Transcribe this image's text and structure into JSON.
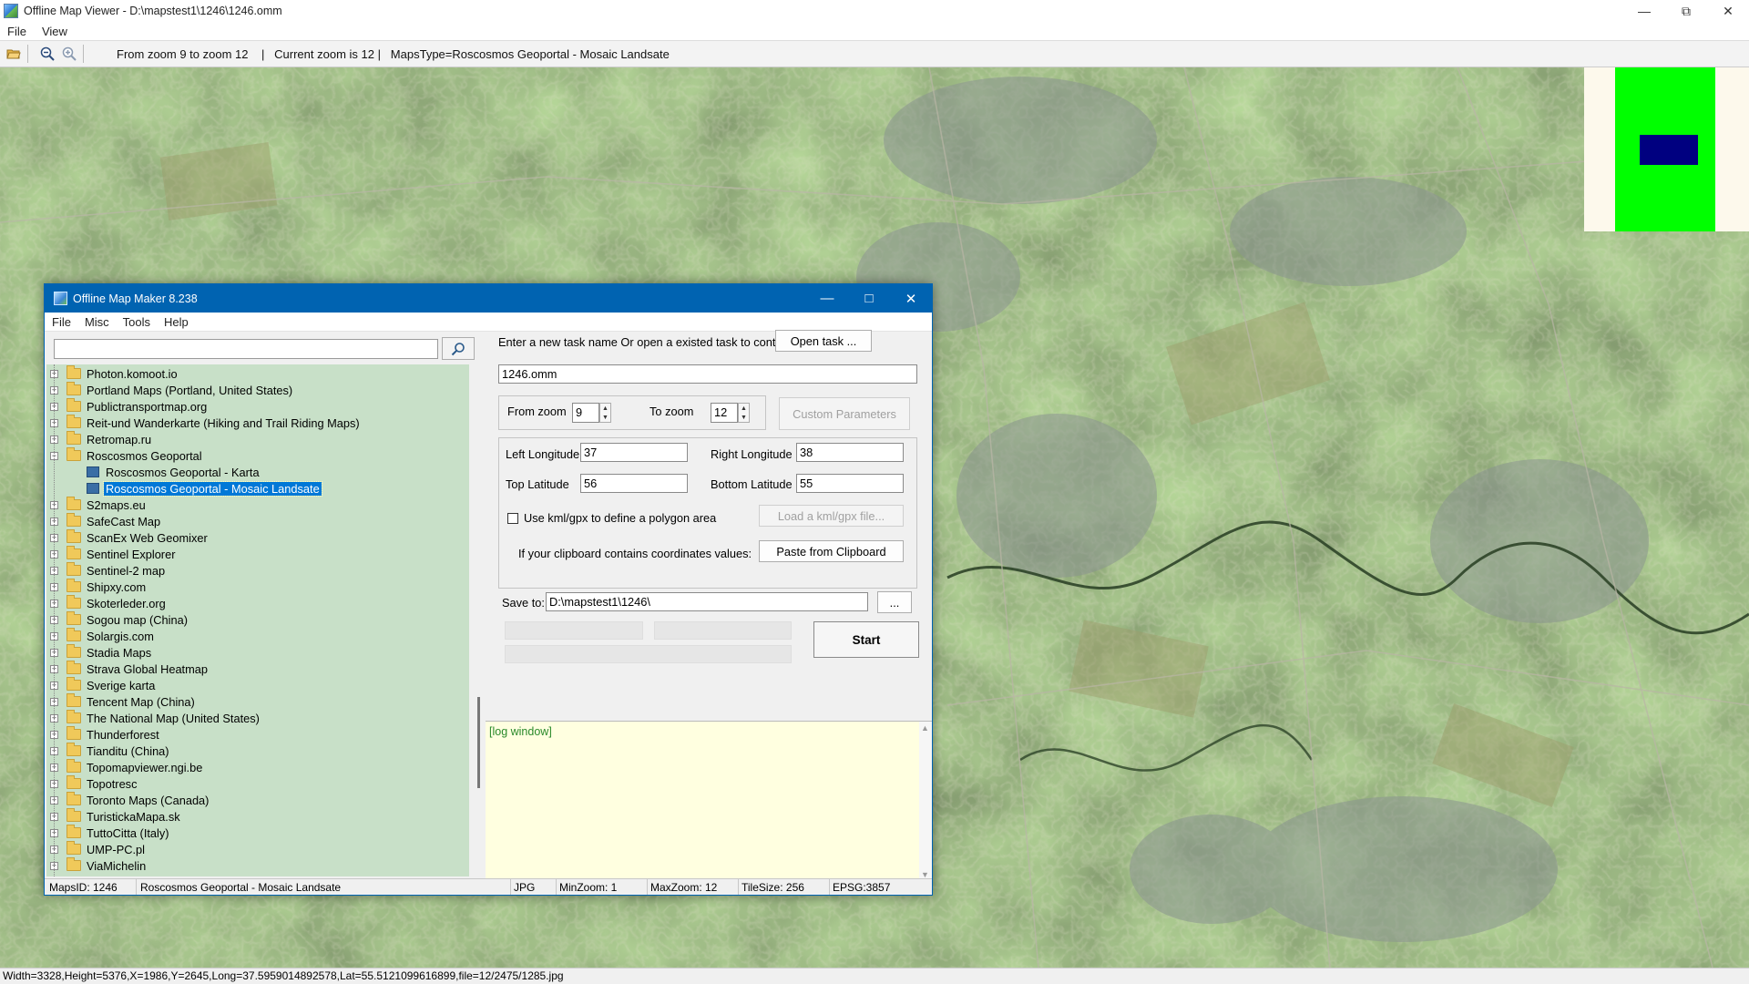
{
  "viewer": {
    "title": "Offline Map Viewer - D:\\mapstest1\\1246\\1246.omm",
    "menu": [
      "File",
      "View"
    ],
    "toolbar_info": "From zoom 9 to zoom 12    |   Current zoom is 12 |   MapsType=Roscosmos Geoportal - Mosaic Landsate",
    "status": "Width=3328,Height=5376,X=1986,Y=2645,Long=37.5959014892578,Lat=55.5121099616899,file=12/2475/1285.jpg",
    "icons": [
      "folder-open-icon",
      "zoom-out-icon",
      "zoom-in-icon"
    ],
    "colors": {
      "minimap_bg": "#fdf9ec",
      "minimap_map": "#00ff00",
      "minimap_view": "#000080"
    }
  },
  "dialog": {
    "title": "Offline Map Maker 8.238",
    "menu": [
      "File",
      "Misc",
      "Tools",
      "Help"
    ],
    "search": {
      "value": "",
      "placeholder": ""
    },
    "tree": [
      {
        "label": "Photon.komoot.io",
        "type": "folder"
      },
      {
        "label": "Portland Maps (Portland, United States)",
        "type": "folder"
      },
      {
        "label": "Publictransportmap.org",
        "type": "folder"
      },
      {
        "label": "Reit-und Wanderkarte (Hiking and Trail Riding Maps)",
        "type": "folder"
      },
      {
        "label": "Retromap.ru",
        "type": "folder"
      },
      {
        "label": "Roscosmos Geoportal",
        "type": "folder-open"
      },
      {
        "label": "Roscosmos Geoportal - Karta",
        "type": "map"
      },
      {
        "label": "Roscosmos Geoportal - Mosaic Landsate",
        "type": "map-selected"
      },
      {
        "label": "S2maps.eu",
        "type": "folder"
      },
      {
        "label": "SafeCast Map",
        "type": "folder"
      },
      {
        "label": "ScanEx Web Geomixer",
        "type": "folder"
      },
      {
        "label": "Sentinel Explorer",
        "type": "folder"
      },
      {
        "label": "Sentinel-2 map",
        "type": "folder"
      },
      {
        "label": "Shipxy.com",
        "type": "folder"
      },
      {
        "label": "Skoterleder.org",
        "type": "folder"
      },
      {
        "label": "Sogou map (China)",
        "type": "folder"
      },
      {
        "label": "Solargis.com",
        "type": "folder"
      },
      {
        "label": "Stadia Maps",
        "type": "folder"
      },
      {
        "label": "Strava Global Heatmap",
        "type": "folder"
      },
      {
        "label": "Sverige karta",
        "type": "folder"
      },
      {
        "label": "Tencent Map (China)",
        "type": "folder"
      },
      {
        "label": "The National Map (United States)",
        "type": "folder"
      },
      {
        "label": "Thunderforest",
        "type": "folder"
      },
      {
        "label": "Tianditu (China)",
        "type": "folder"
      },
      {
        "label": "Topomapviewer.ngi.be",
        "type": "folder"
      },
      {
        "label": "Topotresc",
        "type": "folder"
      },
      {
        "label": "Toronto Maps (Canada)",
        "type": "folder"
      },
      {
        "label": "TuristickaMapa.sk",
        "type": "folder"
      },
      {
        "label": "TuttoCitta (Italy)",
        "type": "folder"
      },
      {
        "label": "UMP-PC.pl",
        "type": "folder"
      },
      {
        "label": "ViaMichelin",
        "type": "folder"
      }
    ],
    "task_prompt": "Enter a new task name Or open a existed task to continue:",
    "open_task_label": "Open task ...",
    "task_name": "1246.omm",
    "from_zoom_label": "From zoom",
    "from_zoom": "9",
    "to_zoom_label": "To zoom",
    "to_zoom": "12",
    "custom_params_label": "Custom Parameters",
    "left_lon_label": "Left Longitude",
    "left_lon": "37",
    "right_lon_label": "Right Longitude",
    "right_lon": "38",
    "top_lat_label": "Top Latitude",
    "top_lat": "56",
    "bottom_lat_label": "Bottom Latitude",
    "bottom_lat": "55",
    "kml_label": "Use kml/gpx to define a polygon area",
    "kml_checked": false,
    "load_kml_label": "Load a kml/gpx file...",
    "clipboard_label": "If your clipboard contains coordinates values:",
    "paste_label": "Paste from Clipboard",
    "save_to_label": "Save to:",
    "save_to": "D:\\mapstest1\\1246\\",
    "browse_label": "...",
    "start_label": "Start",
    "log_text": "[log window]",
    "status": {
      "maps_id": "MapsID: 1246",
      "name": "Roscosmos Geoportal - Mosaic Landsate",
      "format": "JPG",
      "min_zoom": "MinZoom: 1",
      "max_zoom": "MaxZoom: 12",
      "tile_size": "TileSize: 256",
      "epsg": "EPSG:3857"
    }
  }
}
